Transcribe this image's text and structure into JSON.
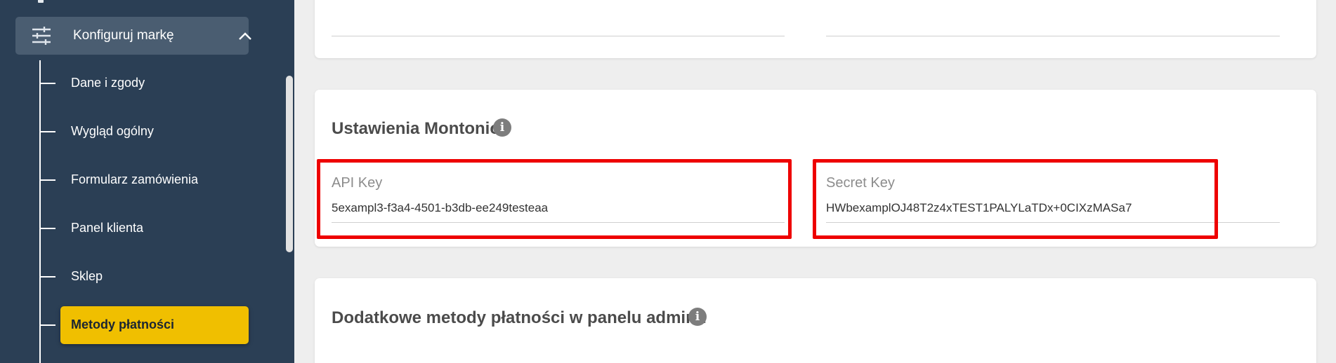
{
  "sidebar": {
    "group": {
      "label": "Konfiguruj markę",
      "icon": "sliders-icon",
      "expand_icon": "chevron-up-icon"
    },
    "items": [
      {
        "label": "Dane i zgody"
      },
      {
        "label": "Wygląd ogólny"
      },
      {
        "label": "Formularz zamówienia"
      },
      {
        "label": "Panel klienta"
      },
      {
        "label": "Sklep"
      },
      {
        "label": "Metody płatności",
        "active": true
      }
    ]
  },
  "montonio": {
    "title": "Ustawienia Montonio",
    "info_icon": "info-icon",
    "api_key": {
      "label": "API Key",
      "value": "5exampl3-f3a4-4501-b3db-ee249testeaa"
    },
    "secret_key": {
      "label": "Secret Key",
      "value": "HWbexamplOJ48T2z4xTEST1PALYLaTDx+0CIXzMASa7"
    }
  },
  "extra_methods": {
    "title": "Dodatkowe metody płatności w panelu admina",
    "info_icon": "info-icon"
  },
  "colors": {
    "sidebar_bg": "#2b3f55",
    "active_item": "#f0bf00",
    "highlight": "#ee0000"
  }
}
